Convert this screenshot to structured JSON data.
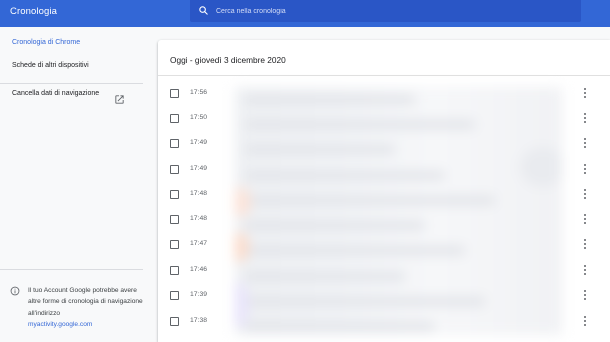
{
  "header": {
    "title": "Cronologia",
    "search_placeholder": "Cerca nella cronologia"
  },
  "sidebar": {
    "active_item": "Cronologia di Chrome",
    "other_item": "Schede di altri dispositivi",
    "clear_data_label": "Cancella dati di navigazione",
    "info_text": "Il tuo Account Google potrebbe avere altre forme di cronologia di navigazione all'indirizzo",
    "info_link": "myactivity.google.com"
  },
  "main": {
    "section_title": "Oggi - giovedì 3 dicembre 2020",
    "entries": [
      {
        "time": "17:56"
      },
      {
        "time": "17:50"
      },
      {
        "time": "17:49"
      },
      {
        "time": "17:49"
      },
      {
        "time": "17:48"
      },
      {
        "time": "17:48"
      },
      {
        "time": "17:47"
      },
      {
        "time": "17:46"
      },
      {
        "time": "17:39"
      },
      {
        "time": "17:38"
      }
    ]
  },
  "colors": {
    "accent": "#3367d6",
    "search_bg": "#2a56c6",
    "icon_gray": "#5f6368"
  },
  "icons": {
    "search": "search-icon",
    "open_external": "open-in-new-icon",
    "info": "info-icon",
    "row_menu": "more-vert-icon"
  }
}
